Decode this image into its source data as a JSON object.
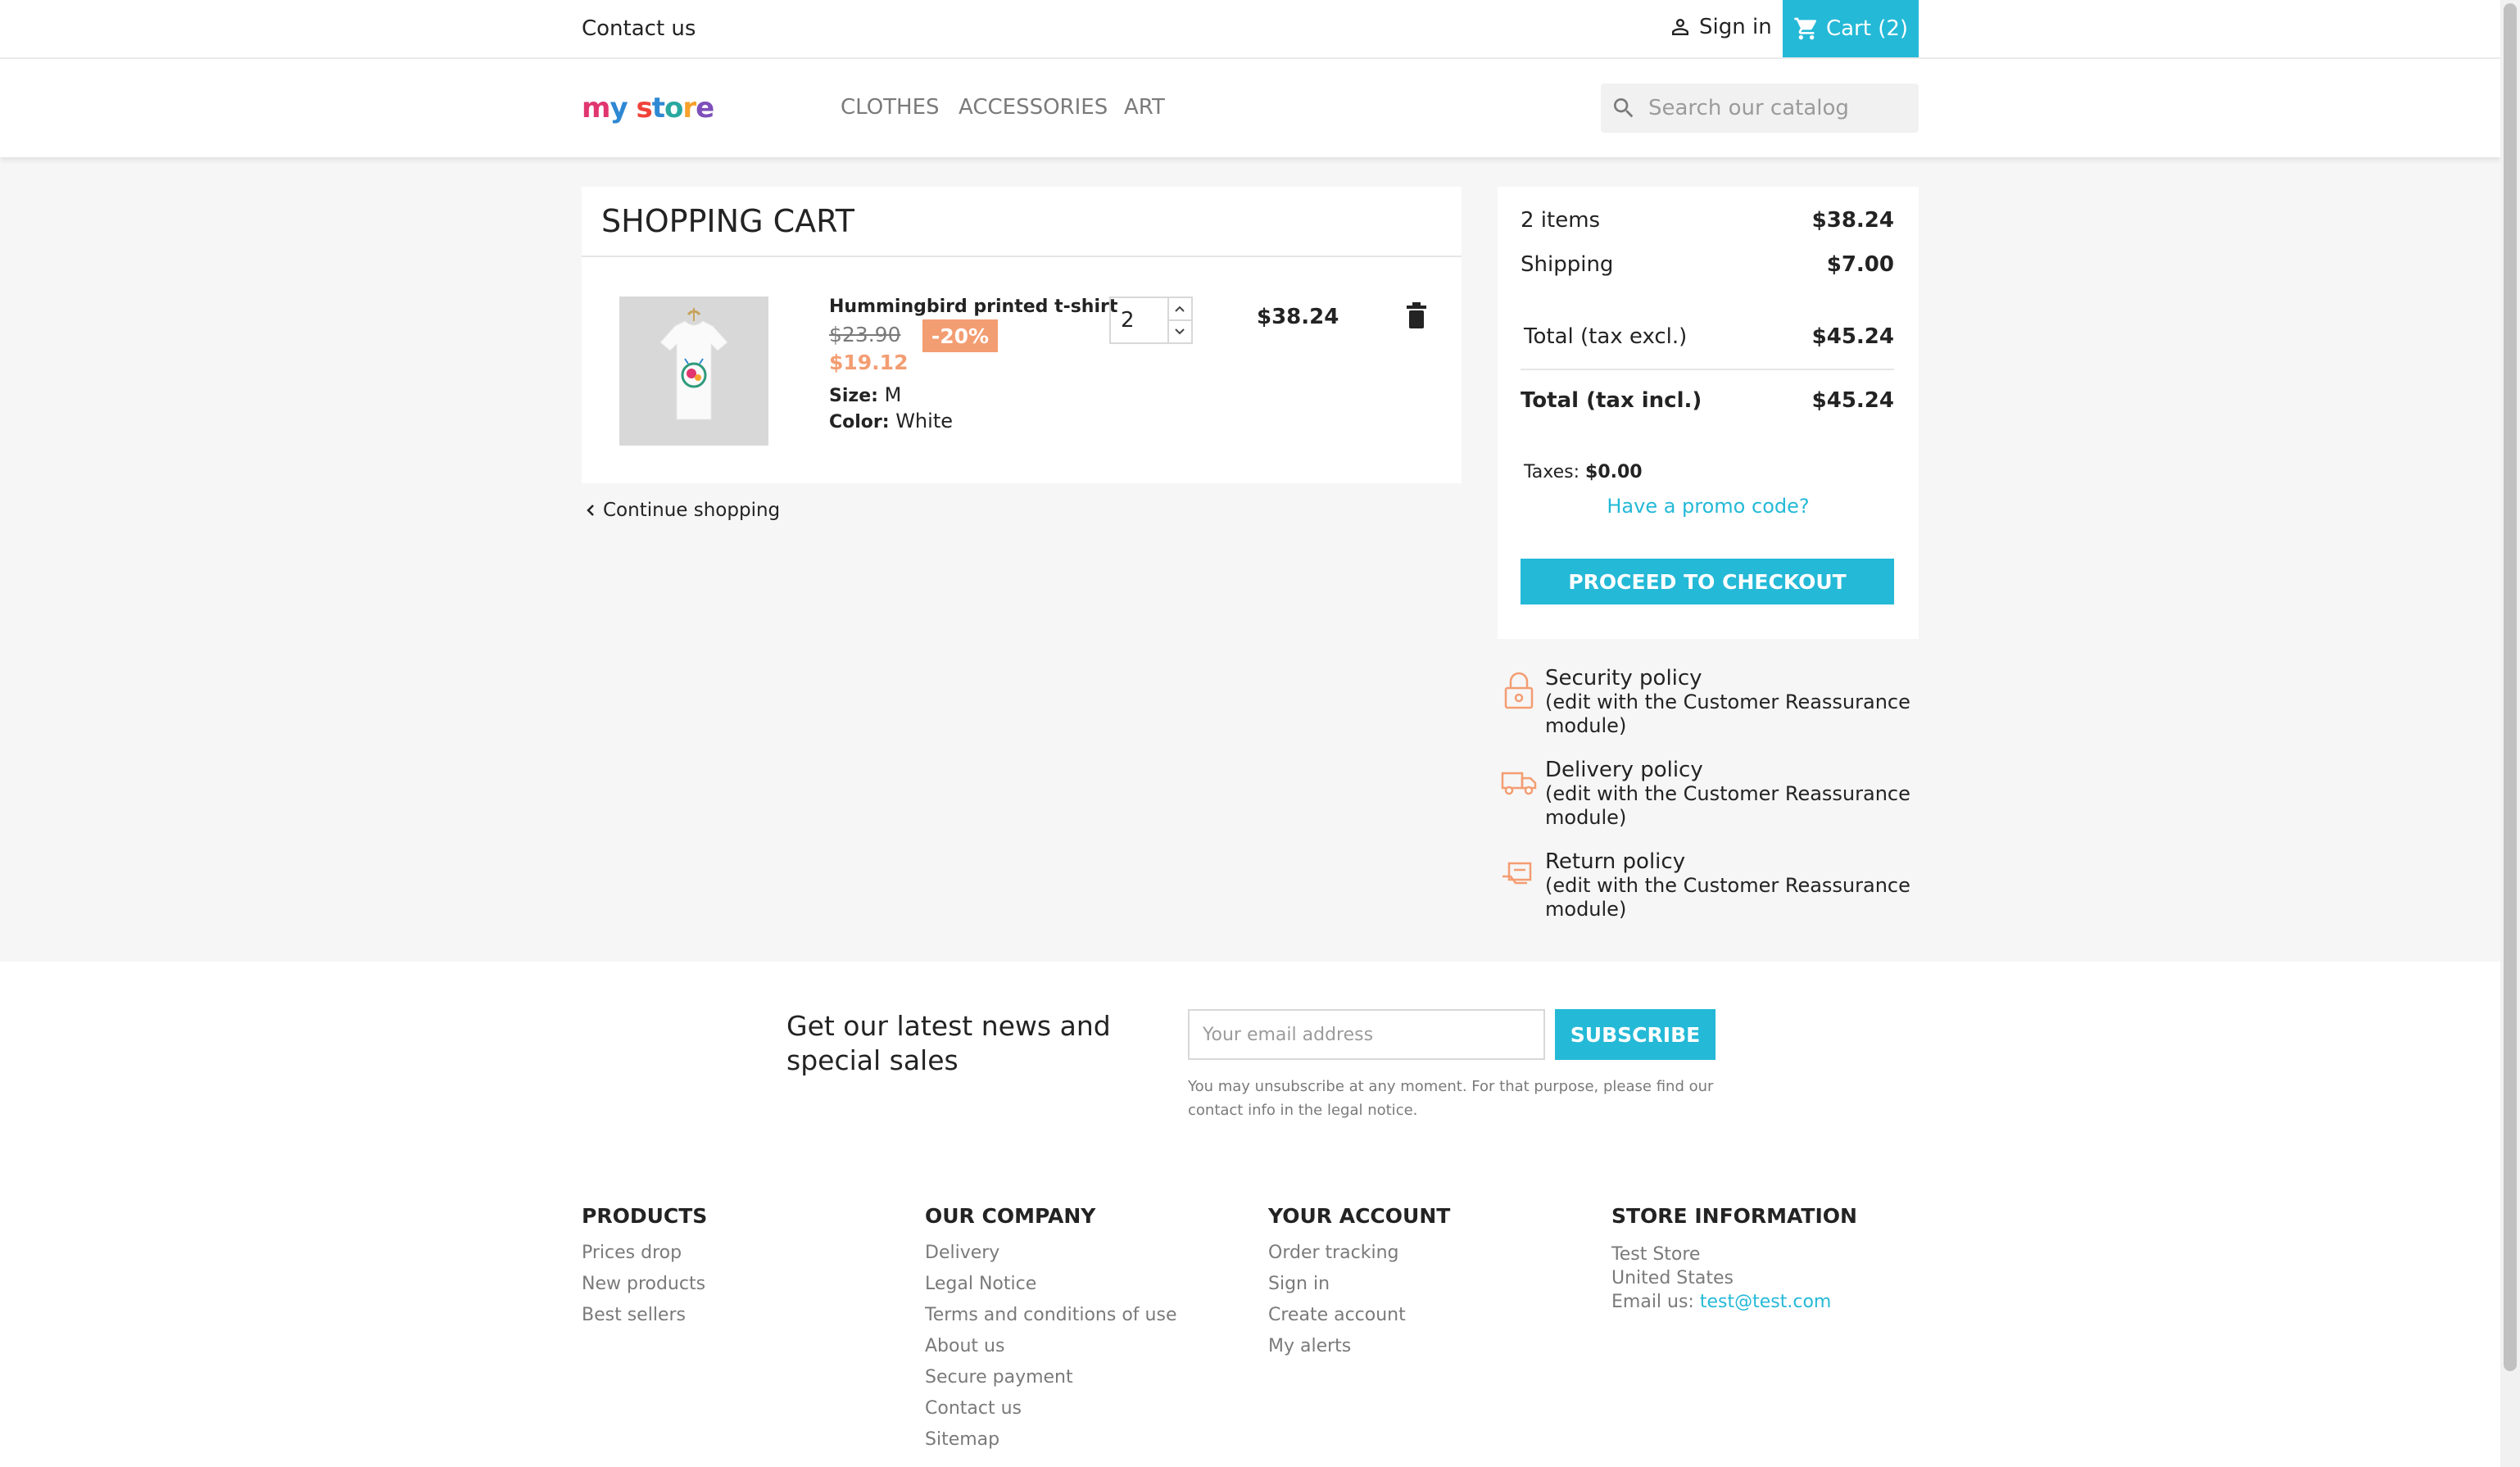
{
  "topbar": {
    "contact": "Contact us",
    "signin": "Sign in",
    "cart": "Cart (2)"
  },
  "header": {
    "logo": {
      "m": "m",
      "y": "y",
      "s1": "s",
      "s2": "t",
      "s3": "o",
      "s4": "r",
      "s5": "e"
    },
    "nav": [
      "CLOTHES",
      "ACCESSORIES",
      "ART"
    ],
    "search_placeholder": "Search our catalog"
  },
  "cart": {
    "title": "SHOPPING CART",
    "item": {
      "name": "Hummingbird printed t-shirt",
      "regular_price": "$23.90",
      "discount": "-20%",
      "price": "$19.12",
      "size_label": "Size:",
      "size": "M",
      "color_label": "Color:",
      "color": "White",
      "quantity": "2",
      "total": "$38.24"
    },
    "continue": "Continue shopping"
  },
  "summary": {
    "items_label": "2 items",
    "items_value": "$38.24",
    "shipping_label": "Shipping",
    "shipping_value": "$7.00",
    "excl_label": "Total (tax excl.)",
    "excl_value": "$45.24",
    "incl_label": "Total (tax incl.)",
    "incl_value": "$45.24",
    "taxes_label": "Taxes:",
    "taxes_value": "$0.00",
    "promo": "Have a promo code?",
    "checkout": "PROCEED TO CHECKOUT"
  },
  "reassurance": [
    {
      "title": "Security policy",
      "sub": "(edit with the Customer Reassurance module)"
    },
    {
      "title": "Delivery policy",
      "sub": "(edit with the Customer Reassurance module)"
    },
    {
      "title": "Return policy",
      "sub": "(edit with the Customer Reassurance module)"
    }
  ],
  "newsletter": {
    "title": "Get our latest news and special sales",
    "placeholder": "Your email address",
    "button": "SUBSCRIBE",
    "note": "You may unsubscribe at any moment. For that purpose, please find our contact info in the legal notice."
  },
  "footer": {
    "products": {
      "title": "PRODUCTS",
      "links": [
        "Prices drop",
        "New products",
        "Best sellers"
      ]
    },
    "company": {
      "title": "OUR COMPANY",
      "links": [
        "Delivery",
        "Legal Notice",
        "Terms and conditions of use",
        "About us",
        "Secure payment",
        "Contact us",
        "Sitemap"
      ]
    },
    "account": {
      "title": "YOUR ACCOUNT",
      "links": [
        "Order tracking",
        "Sign in",
        "Create account",
        "My alerts"
      ]
    },
    "store": {
      "title": "STORE INFORMATION",
      "name": "Test Store",
      "country": "United States",
      "email_label": "Email us:",
      "email": "test@test.com"
    }
  },
  "colors": {
    "accent": "#24b9d7",
    "discount": "#f39d72",
    "background": "#f6f6f6"
  },
  "icons": {
    "signin": "person-icon",
    "cart": "shopping-cart-icon",
    "search": "search-icon",
    "delete": "trash-icon",
    "continue": "chevron-left-icon"
  }
}
